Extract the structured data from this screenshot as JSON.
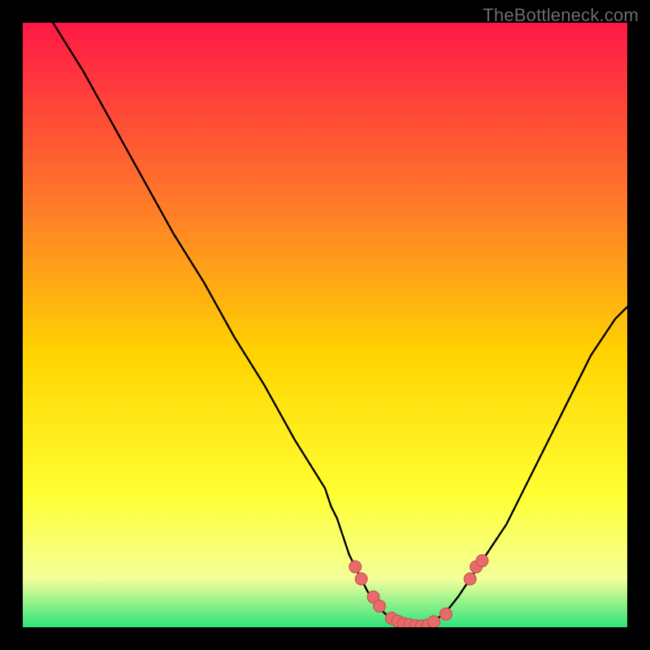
{
  "watermark": "TheBottleneck.com",
  "colors": {
    "grad_top": "#ff1846",
    "grad_mid_upper": "#ff7a2a",
    "grad_mid": "#ffd400",
    "grad_mid_lower": "#ffff33",
    "grad_light": "#f4ff9a",
    "grad_green": "#2ee37a",
    "curve": "#000000",
    "marker_fill": "#e86a6a",
    "marker_stroke": "#c24f4f"
  },
  "chart_data": {
    "type": "line",
    "title": "",
    "xlabel": "",
    "ylabel": "",
    "xlim": [
      0,
      100
    ],
    "ylim": [
      0,
      100
    ],
    "x": [
      5,
      10,
      15,
      20,
      25,
      30,
      35,
      40,
      45,
      50,
      51,
      52,
      53,
      54,
      55,
      56,
      57,
      58,
      59,
      60,
      61,
      62,
      63,
      64,
      65,
      66,
      67,
      68,
      70,
      72,
      74,
      76,
      78,
      80,
      82,
      84,
      86,
      88,
      90,
      92,
      94,
      96,
      98,
      100
    ],
    "values": [
      100,
      92,
      83,
      74,
      65,
      57,
      48,
      40,
      31,
      23,
      20,
      18,
      15,
      12,
      10,
      8,
      6,
      4.5,
      3.2,
      2.2,
      1.5,
      1.0,
      0.6,
      0.35,
      0.2,
      0.2,
      0.4,
      1.0,
      2.5,
      5,
      8,
      11,
      14,
      17,
      21,
      25,
      29,
      33,
      37,
      41,
      45,
      48,
      51,
      53
    ],
    "markers": [
      {
        "x": 55,
        "y": 10
      },
      {
        "x": 56,
        "y": 8
      },
      {
        "x": 58,
        "y": 5
      },
      {
        "x": 59,
        "y": 3.5
      },
      {
        "x": 61,
        "y": 1.5
      },
      {
        "x": 62,
        "y": 1.0
      },
      {
        "x": 63,
        "y": 0.6
      },
      {
        "x": 64,
        "y": 0.4
      },
      {
        "x": 65,
        "y": 0.25
      },
      {
        "x": 66,
        "y": 0.2
      },
      {
        "x": 67,
        "y": 0.35
      },
      {
        "x": 68,
        "y": 0.9
      },
      {
        "x": 70,
        "y": 2.2
      },
      {
        "x": 74,
        "y": 8
      },
      {
        "x": 75,
        "y": 10
      },
      {
        "x": 76,
        "y": 11
      }
    ]
  }
}
